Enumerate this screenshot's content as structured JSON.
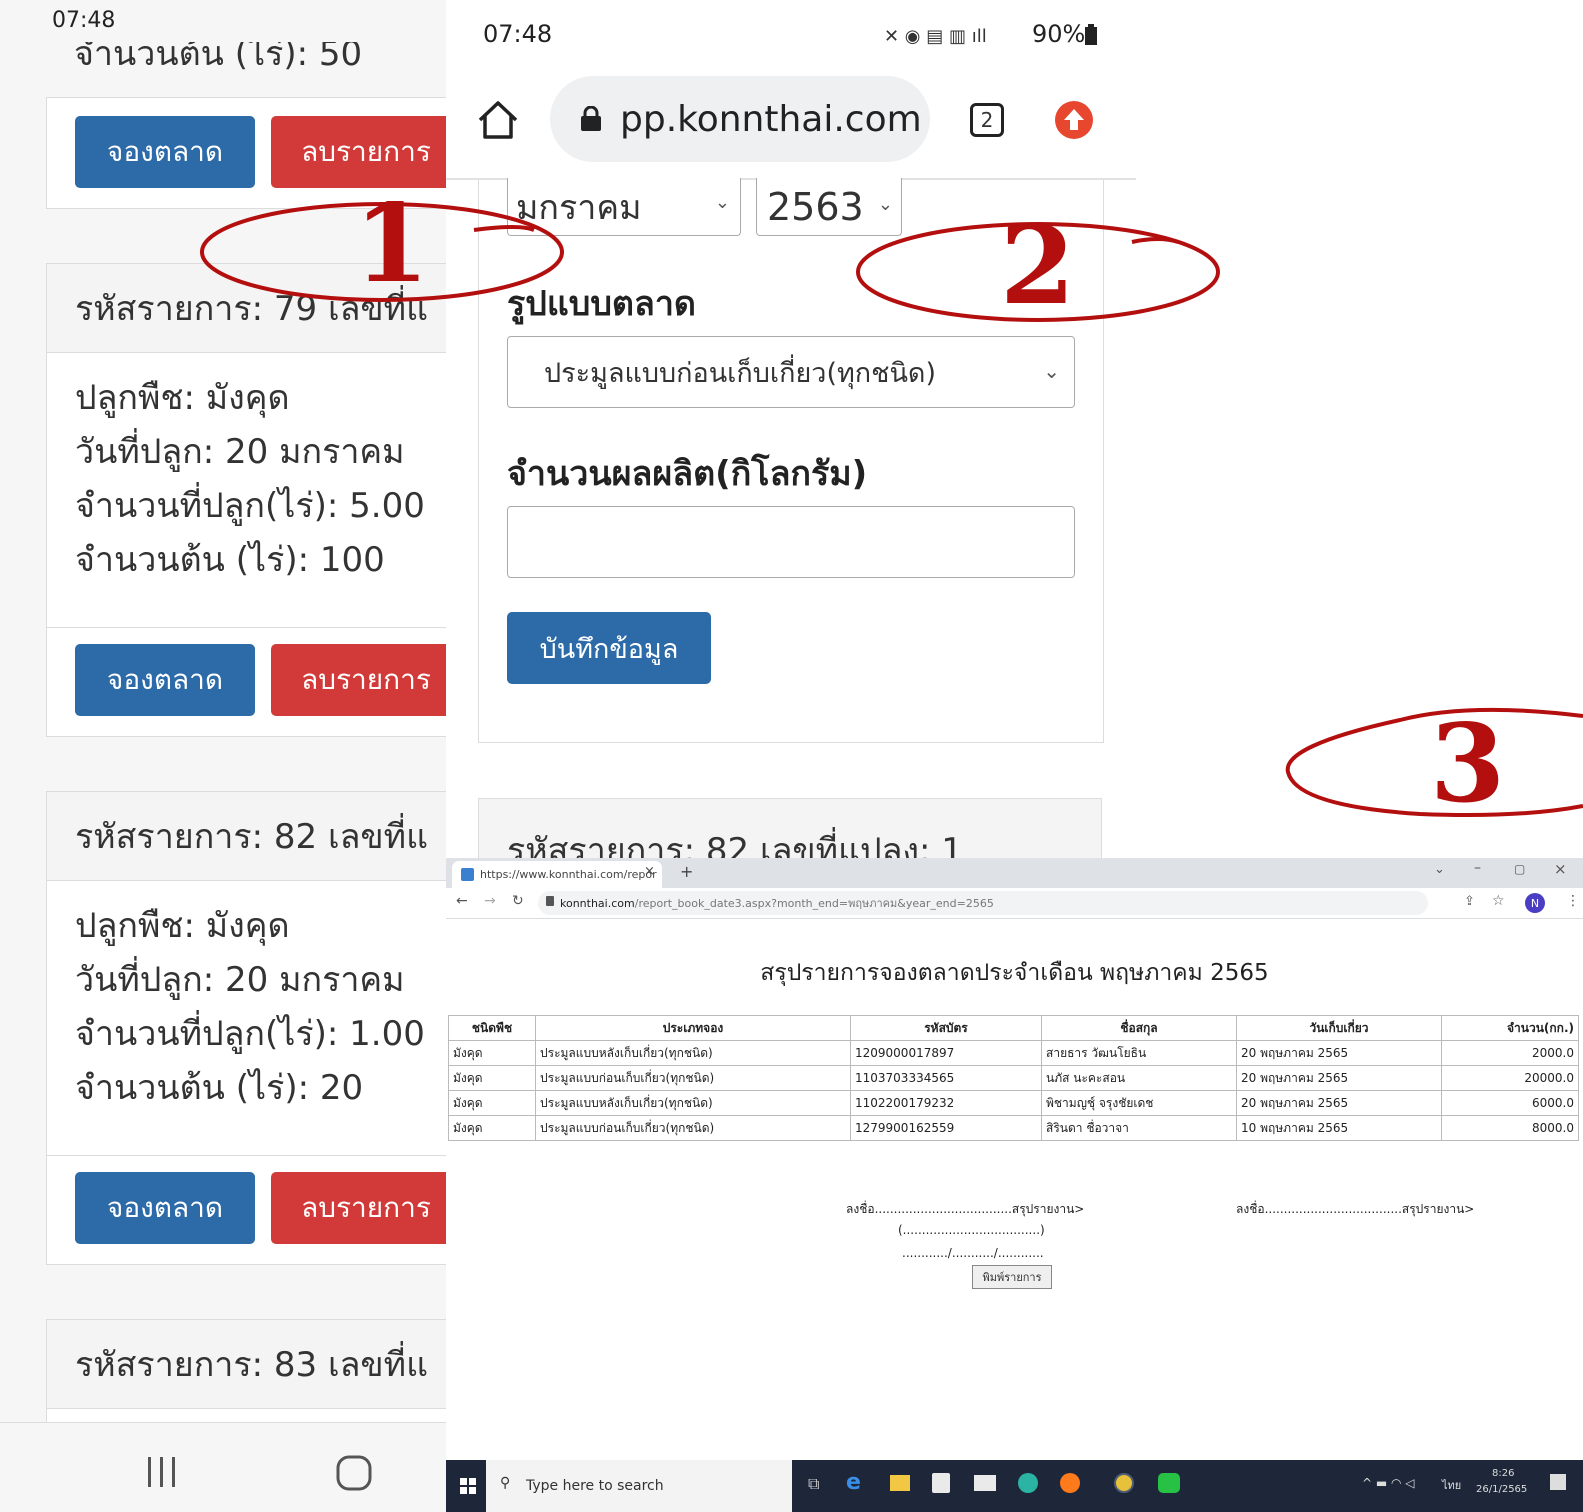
{
  "left_phone": {
    "time": "07:48",
    "top_partial": "จำนวนต้น (ไร่): 50",
    "book_label": "จองตลาด",
    "delete_label": "ลบรายการ",
    "card1": {
      "header": "รหัสรายการ: 79 เลขที่แ",
      "crop": "ปลูกพืช: มังคุด",
      "plant_date": "วันที่ปลูก: 20 มกราคม",
      "area": "จำนวนที่ปลูก(ไร่): 5.00",
      "trees": "จำนวนต้น (ไร่): 100"
    },
    "card2": {
      "header": "รหัสรายการ: 82 เลขที่แ",
      "crop": "ปลูกพืช: มังคุด",
      "plant_date": "วันที่ปลูก: 20 มกราคม",
      "area": "จำนวนที่ปลูก(ไร่): 1.00",
      "trees": "จำนวนต้น (ไร่): 20"
    },
    "card3": {
      "header": "รหัสรายการ: 83 เลขที่แ"
    }
  },
  "mid_phone": {
    "time": "07:48",
    "battery": "90%",
    "url": "pp.konnthai.com",
    "tab_count": "2",
    "month_value": "มกราคม",
    "year_value": "2563",
    "market_label": "รูปแบบตลาด",
    "market_value": "ประมูลแบบก่อนเก็บเกี่ยว(ทุกชนิด)",
    "qty_label": "จำนวนผลผลิต(กิโลกรัม)",
    "qty_value": "",
    "save_label": "บันทึกข้อมูล",
    "next_card_header": "รหัสรายการ: 82 เลขที่แปลง: 1"
  },
  "desktop": {
    "tab_title": "https://www.konnthai.com/repor",
    "url_domain": "konnthai.com",
    "url_path": "/report_book_date3.aspx?month_end=พฤษภาคม&year_end=2565",
    "avatar": "N",
    "report_title": "สรุปรายการจองตลาดประจำเดือน พฤษภาคม  2565",
    "columns": [
      "ชนิดพืช",
      "ประเภทจอง",
      "รหัสบัตร",
      "ชื่อสกุล",
      "วันเก็บเกี่ยว",
      "จำนวน(กก.)"
    ],
    "rows": [
      [
        "มังคุด",
        "ประมูลแบบหลังเก็บเกี่ยว(ทุกชนิด)",
        "1209000017897",
        "สายธาร วัฒนโยธิน",
        "20 พฤษภาคม 2565",
        "2000.0"
      ],
      [
        "มังคุด",
        "ประมูลแบบก่อนเก็บเกี่ยว(ทุกชนิด)",
        "1103703334565",
        "นภัส นะคะสอน",
        "20 พฤษภาคม 2565",
        "20000.0"
      ],
      [
        "มังคุด",
        "ประมูลแบบหลังเก็บเกี่ยว(ทุกชนิด)",
        "1102200179232",
        "พิชามญชุ์ จรุงชัยเดช",
        "20 พฤษภาคม 2565",
        "6000.0"
      ],
      [
        "มังคุด",
        "ประมูลแบบก่อนเก็บเกี่ยว(ทุกชนิด)",
        "1279900162559",
        "สิรินดา ชื่อวาจา",
        "10 พฤษภาคม 2565",
        "8000.0"
      ]
    ],
    "sign_left": "ลงชื่อ....................................สรุปรายงาน>",
    "sign_left_paren": "(....................................)",
    "sign_left_date": "............/.........../............",
    "sign_right": "ลงชื่อ....................................สรุปรายงาน>",
    "print_label": "พิมพ์รายการ",
    "search_placeholder": "Type here to search",
    "clock_time": "8:26",
    "clock_date": "26/1/2565",
    "lang": "ไทย"
  },
  "annotations": [
    "1",
    "2",
    "3"
  ],
  "colors": {
    "annotation": "#b40f0f",
    "btn_blue": "#2c6aa8",
    "btn_red": "#d23a3a"
  }
}
